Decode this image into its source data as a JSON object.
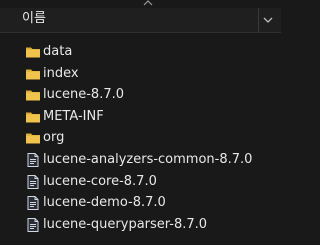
{
  "header": {
    "column_label": "이름",
    "sort_icon": "chevron-up-icon",
    "menu_icon": "chevron-down-icon"
  },
  "files": [
    {
      "name": "data",
      "type": "folder",
      "icon": "folder-icon"
    },
    {
      "name": "index",
      "type": "folder",
      "icon": "folder-icon"
    },
    {
      "name": "lucene-8.7.0",
      "type": "folder",
      "icon": "folder-icon"
    },
    {
      "name": "META-INF",
      "type": "folder",
      "icon": "folder-icon"
    },
    {
      "name": "org",
      "type": "folder",
      "icon": "folder-icon"
    },
    {
      "name": "lucene-analyzers-common-8.7.0",
      "type": "file",
      "icon": "file-icon"
    },
    {
      "name": "lucene-core-8.7.0",
      "type": "file",
      "icon": "file-icon"
    },
    {
      "name": "lucene-demo-8.7.0",
      "type": "file",
      "icon": "file-icon"
    },
    {
      "name": "lucene-queryparser-8.7.0",
      "type": "file",
      "icon": "file-icon"
    }
  ],
  "colors": {
    "background": "#191919",
    "text": "#e8e8e8",
    "folder": "#f0c44c",
    "folder_dark": "#d9a93a",
    "file_icon": "#cfd6e4"
  }
}
